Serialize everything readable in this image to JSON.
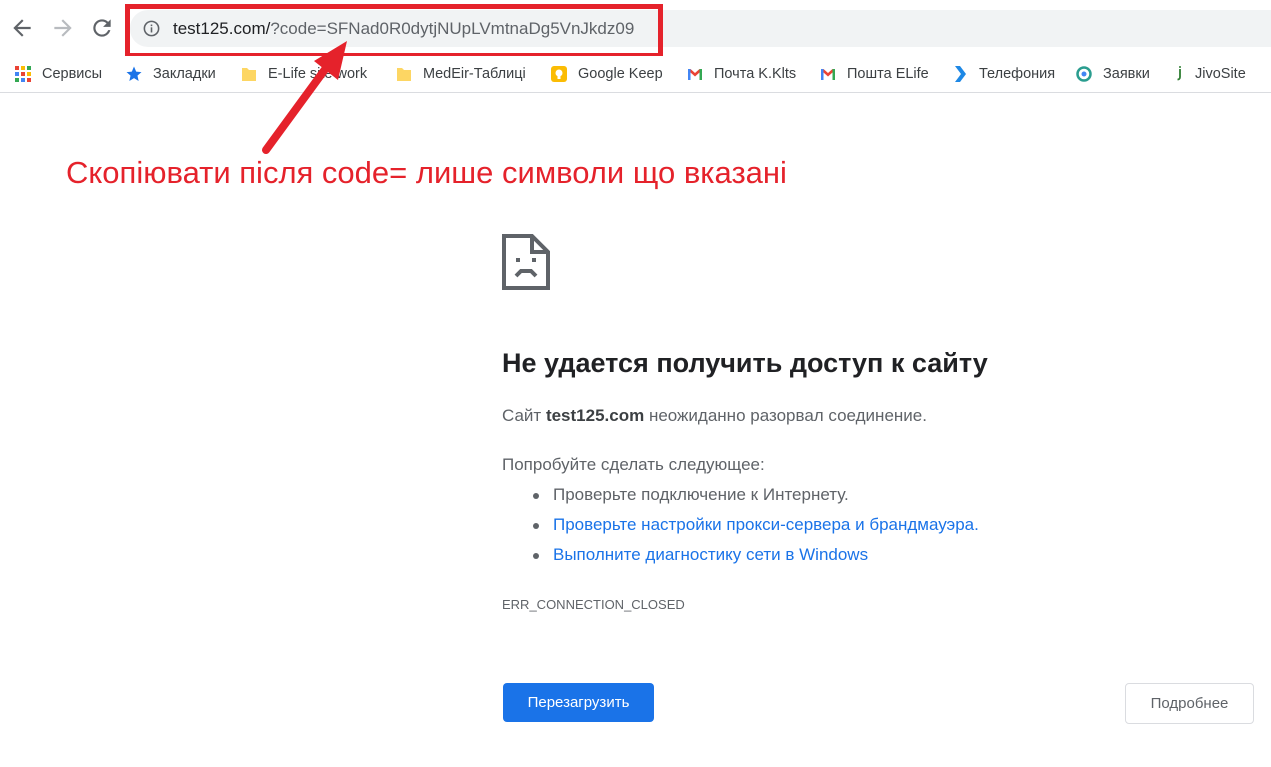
{
  "toolbar": {
    "back_icon": "arrow-left-icon",
    "forward_icon": "arrow-right-icon",
    "reload_icon": "reload-icon",
    "info_icon": "info-icon",
    "url_host": "test125.com/",
    "url_query": "?code=SFNad0R0dytjNUpLVmtnaDg5VnJkdz09"
  },
  "bookmarks": [
    {
      "label": "Сервисы",
      "icon": "apps-grid-icon"
    },
    {
      "label": "Закладки",
      "icon": "star-icon"
    },
    {
      "label": "E-Life site work",
      "icon": "folder-icon"
    },
    {
      "label": "MedEir-Таблиці",
      "icon": "folder-icon"
    },
    {
      "label": "Google Keep",
      "icon": "keep-icon"
    },
    {
      "label": "Почта K.Klts",
      "icon": "gmail-icon"
    },
    {
      "label": "Пошта ELife",
      "icon": "gmail-icon"
    },
    {
      "label": "Телефония",
      "icon": "chevron-logo-icon"
    },
    {
      "label": "Заявки",
      "icon": "ring-logo-icon"
    },
    {
      "label": "JivoSite",
      "icon": "jivo-logo-icon"
    }
  ],
  "annotation": {
    "text": "Скопіювати після code= лише символи що вказані",
    "color": "#e5222b"
  },
  "error": {
    "icon": "sad-page-icon",
    "title": "Не удается получить доступ к сайту",
    "site_prefix": "Сайт ",
    "site_name": "test125.com",
    "site_suffix": " неожиданно разорвал соединение.",
    "try_label": "Попробуйте сделать следующее:",
    "suggestions": [
      "Проверьте подключение к Интернету.",
      "Проверьте настройки прокси-сервера и брандмауэра.",
      "Выполните диагностику сети в Windows"
    ],
    "code": "ERR_CONNECTION_CLOSED",
    "reload_label": "Перезагрузить",
    "details_label": "Подробнее"
  },
  "colors": {
    "accent": "#1a73e8",
    "annotation": "#e5222b"
  }
}
